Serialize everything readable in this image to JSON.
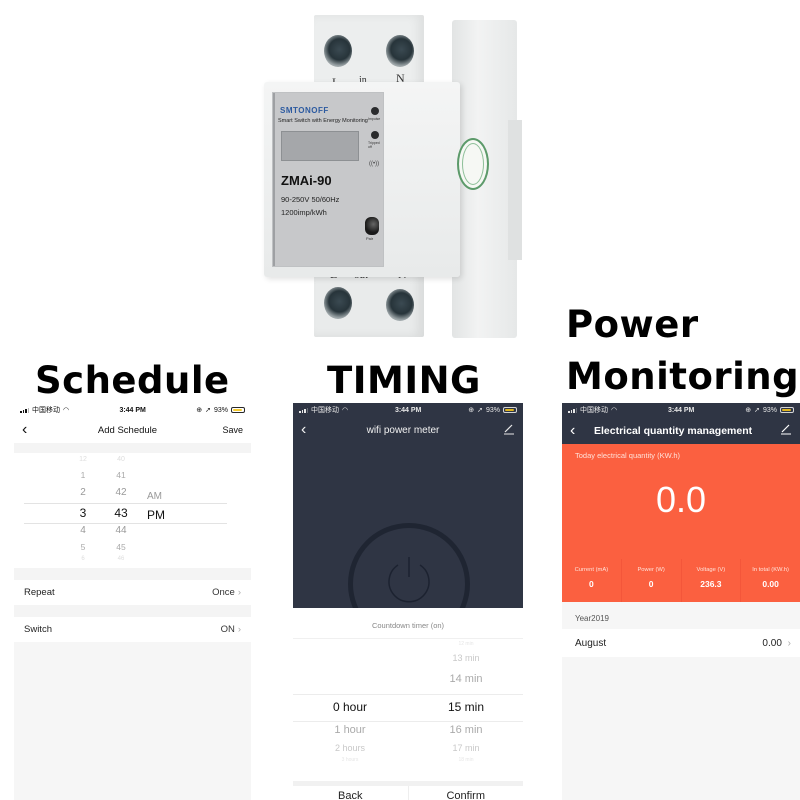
{
  "product": {
    "brand": "SMTONOFF",
    "subtitle": "Smart Switch with Energy Monitoring",
    "model": "ZMAi-90",
    "spec_voltage": "90-250V  50/60Hz",
    "spec_impulse": "1200imp/kWh",
    "led1_label": "Impulse",
    "led2_label": "Tripped off",
    "pair_label": "Pair",
    "terminal_in_l": "L",
    "terminal_in_label": "in",
    "terminal_in_n": "N",
    "terminal_out_l": "L",
    "terminal_out_label": "out",
    "terminal_out_n": "N"
  },
  "headings": {
    "schedule": "Schedule",
    "timing": "TIMING",
    "power_line1": "Power",
    "power_line2": "Monitoring"
  },
  "statusbar": {
    "carrier": "中国移动",
    "time": "3:44 PM",
    "battery": "93%"
  },
  "schedule": {
    "title": "Add Schedule",
    "save": "Save",
    "hours": [
      "12",
      "1",
      "2",
      "3",
      "4",
      "5",
      "6"
    ],
    "minutes": [
      "40",
      "41",
      "42",
      "43",
      "44",
      "45",
      "46"
    ],
    "ampm": [
      "AM",
      "PM"
    ],
    "selected": {
      "hour": "3",
      "minute": "43",
      "period": "PM"
    },
    "rows": [
      {
        "label": "Repeat",
        "value": "Once"
      },
      {
        "label": "Switch",
        "value": "ON"
      }
    ]
  },
  "timing": {
    "title": "wifi power meter",
    "countdown_label": "Countdown timer (on)",
    "hours": [
      "0 hour",
      "1 hour",
      "2 hours",
      "3 hours"
    ],
    "minutes": [
      "12 min",
      "13 min",
      "14 min",
      "15 min",
      "16 min",
      "17 min",
      "18 min"
    ],
    "selected": {
      "hour": "0 hour",
      "minute": "15 min"
    },
    "back": "Back",
    "confirm": "Confirm"
  },
  "power": {
    "title": "Electrical quantity management",
    "today_label": "Today electrical quantity (KW.h)",
    "today_value": "0.0",
    "metrics": [
      {
        "label": "Current  (mA)",
        "value": "0"
      },
      {
        "label": "Power (W)",
        "value": "0"
      },
      {
        "label": "Voltage (V)",
        "value": "236.3"
      },
      {
        "label": "In total (KW.h)",
        "value": "0.00"
      }
    ],
    "year_label": "Year2019",
    "months": [
      {
        "label": "August",
        "value": "0.00"
      }
    ],
    "accent_color": "#fb6040",
    "header_color": "#2f3544"
  }
}
